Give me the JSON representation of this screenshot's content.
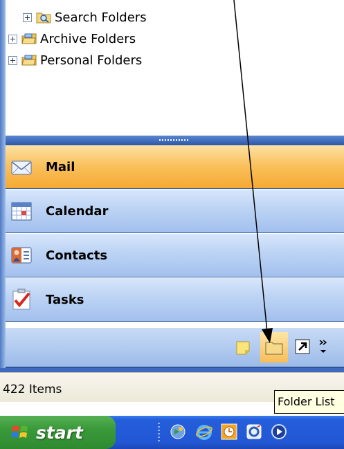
{
  "folder_tree": {
    "items": [
      {
        "label": "Search Folders"
      },
      {
        "label": "Archive Folders"
      },
      {
        "label": "Personal Folders"
      }
    ]
  },
  "nav": {
    "buttons": [
      {
        "label": "Mail",
        "icon": "mail-icon",
        "active": true
      },
      {
        "label": "Calendar",
        "icon": "calendar-icon",
        "active": false
      },
      {
        "label": "Contacts",
        "icon": "contacts-icon",
        "active": false
      },
      {
        "label": "Tasks",
        "icon": "tasks-icon",
        "active": false
      }
    ]
  },
  "iconbar": {
    "icons": [
      "notes-icon",
      "folder-list-icon",
      "shortcuts-icon",
      "configure-buttons-icon"
    ]
  },
  "status": {
    "items_text": "422 Items"
  },
  "tooltip": {
    "text": "Folder List"
  },
  "taskbar": {
    "start_label": "start",
    "quick_launch": [
      "media-icon",
      "internet-explorer-icon",
      "clock-icon",
      "outlook-icon",
      "player-icon"
    ]
  },
  "colors": {
    "active_nav": "#f9bf59",
    "nav": "#bcd3f4",
    "taskbar": "#245edb",
    "start": "#3a9a3a"
  }
}
